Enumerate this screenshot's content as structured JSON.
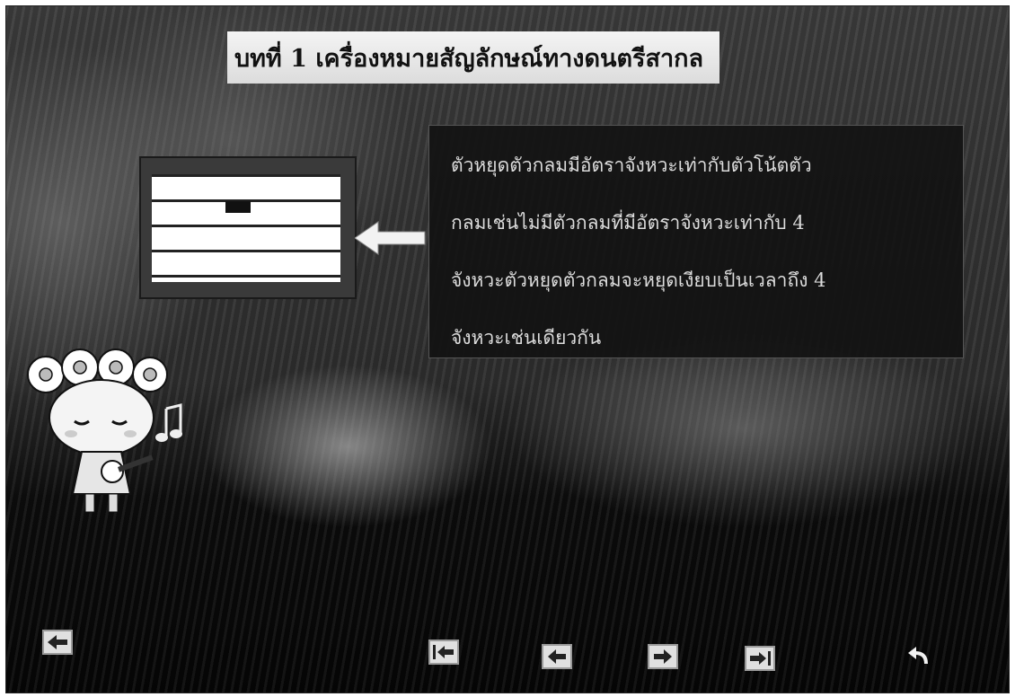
{
  "lesson": {
    "title": "บทที่ 1 เครื่องหมายสัญลักษณ์ทางดนตรีสากล"
  },
  "illustration": {
    "staff_lines": 5,
    "rest_symbol": "whole-rest",
    "pointer": "arrow-left-icon"
  },
  "explanation": {
    "lines": [
      "ตัวหยุดตัวกลมมีอัตราจังหวะเท่ากับตัวโน้ตตัว",
      "กลมเช่นไม่มีตัวกลมที่มีอัตราจังหวะเท่ากับ 4",
      "จังหวะตัวหยุดตัวกลมจะหยุดเงียบเป็นเวลาถึง 4",
      "จังหวะเช่นเดียวกัน"
    ]
  },
  "navigation": {
    "buttons": [
      {
        "name": "exit-button",
        "icon": "exit-arrow-icon"
      },
      {
        "name": "first-page-button",
        "icon": "first-page-icon"
      },
      {
        "name": "previous-button",
        "icon": "arrow-left-icon"
      },
      {
        "name": "next-button",
        "icon": "arrow-right-icon"
      },
      {
        "name": "last-page-button",
        "icon": "last-page-icon"
      },
      {
        "name": "return-button",
        "icon": "return-curved-arrow-icon"
      }
    ]
  },
  "colors": {
    "background": "#2c2c2c",
    "panel": "#121212",
    "panel_text": "#dcdcdc",
    "banner": "#e8e8e8"
  }
}
